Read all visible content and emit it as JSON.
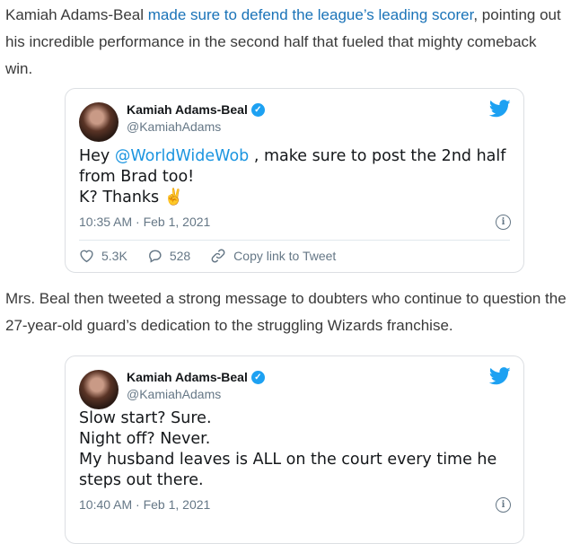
{
  "intro": {
    "prefix": "Kamiah Adams-Beal ",
    "link": "made sure to defend the league’s leading scorer",
    "suffix": ", pointing out his incredible performance in the second half that fueled that mighty comeback win."
  },
  "tweet1": {
    "name": "Kamiah Adams-Beal",
    "handle": "@KamiahAdams",
    "line1_pre": "Hey ",
    "mention": "@WorldWideWob",
    "line1_post": " , make sure to post the 2nd half",
    "line2": "from Brad too!",
    "line3": "K? Thanks ✌️",
    "timestamp": "10:35 AM · Feb 1, 2021",
    "likes": "5.3K",
    "replies": "528",
    "copy_link": "Copy link to Tweet"
  },
  "middle_paragraph": "Mrs. Beal then tweeted a strong message to doubters who continue to question the 27-year-old guard’s dedication to the struggling Wizards franchise.",
  "tweet2": {
    "name": "Kamiah Adams-Beal",
    "handle": "@KamiahAdams",
    "line1": "Slow start? Sure.",
    "line2": "Night off? Never.",
    "line3": "My husband leaves is ALL on the court every time he",
    "line4": "steps out there.",
    "timestamp": "10:40 AM · Feb 1, 2021"
  },
  "colors": {
    "link": "#1a73b8",
    "twitter_blue": "#1da1f2",
    "muted": "#657786"
  },
  "icons": [
    "verified-badge-icon",
    "twitter-bird-icon",
    "info-icon",
    "heart-icon",
    "reply-bubble-icon",
    "link-icon"
  ]
}
